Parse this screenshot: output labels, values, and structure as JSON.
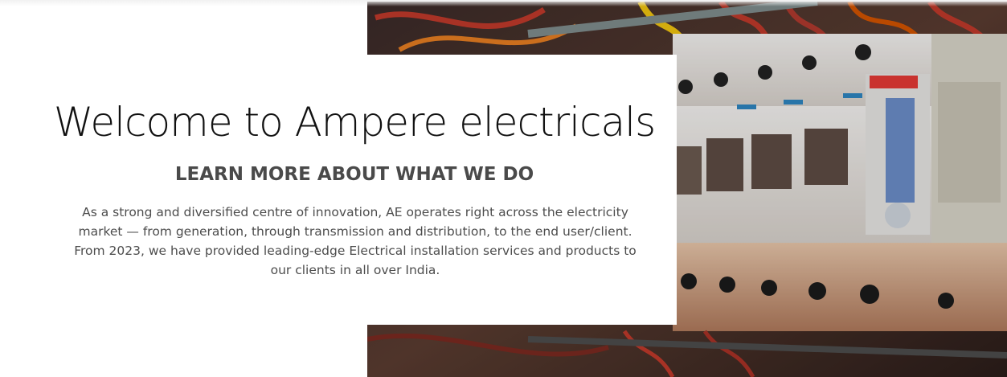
{
  "hero": {
    "title": "Welcome to Ampere electricals",
    "subtitle": "LEARN MORE ABOUT WHAT WE DO",
    "description": "As a strong and diversified centre of innovation, AE operates right across the electricity market — from generation, through transmission and distribution, to the end user/client. From 2023, we have provided leading-edge Electrical installation services and products to our clients in all over India.",
    "image_subject": "electrical-breaker-panel-photo"
  },
  "colors": {
    "heading": "#111111",
    "subheading": "#4a4a4a",
    "body": "#4d4d4d",
    "background": "#ffffff"
  }
}
